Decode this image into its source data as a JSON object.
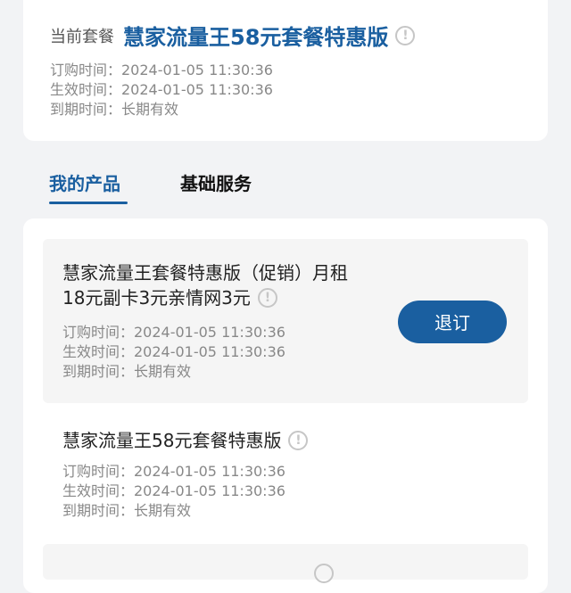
{
  "current_plan": {
    "label": "当前套餐",
    "name": "慧家流量王58元套餐特惠版",
    "order_time": "订购时间：2024-01-05 11:30:36",
    "effective_time": "生效时间：2024-01-05 11:30:36",
    "expire_time": "到期时间：长期有效"
  },
  "tabs": [
    {
      "label": "我的产品"
    },
    {
      "label": "基础服务"
    }
  ],
  "products": [
    {
      "title_line1": "慧家流量王套餐特惠版（促销）月租",
      "title_line2": "18元副卡3元亲情网3元",
      "order_time": "订购时间：2024-01-05 11:30:36",
      "effective_time": "生效时间：2024-01-05 11:30:36",
      "expire_time": "到期时间：长期有效",
      "action_label": "退订"
    },
    {
      "title_line1": "慧家流量王58元套餐特惠版",
      "order_time": "订购时间：2024-01-05 11:30:36",
      "effective_time": "生效时间：2024-01-05 11:30:36",
      "expire_time": "到期时间：长期有效"
    }
  ],
  "icons": {
    "info": "info-circle-icon"
  },
  "colors": {
    "accent": "#1a5fa0"
  }
}
